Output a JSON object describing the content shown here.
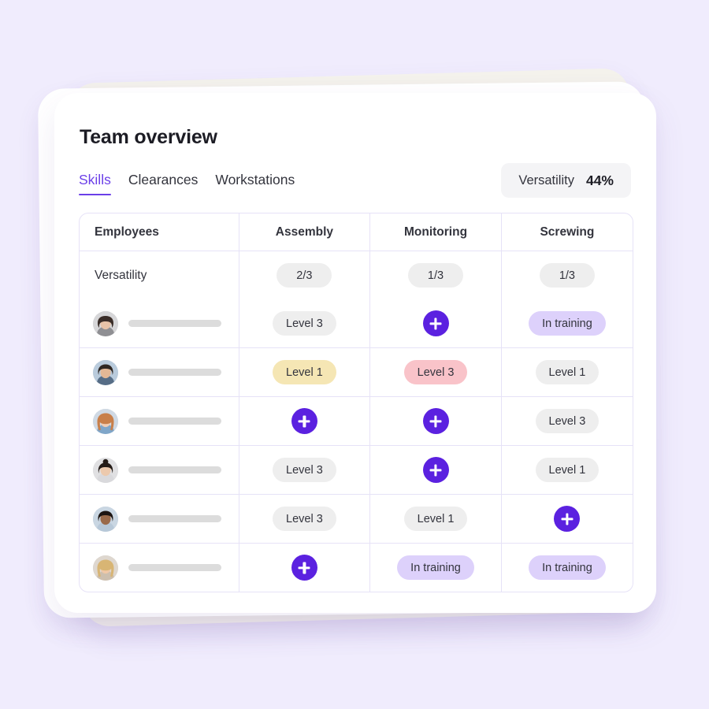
{
  "card": {
    "title": "Team overview",
    "tabs": [
      {
        "label": "Skills",
        "active": true
      },
      {
        "label": "Clearances",
        "active": false
      },
      {
        "label": "Workstations",
        "active": false
      }
    ],
    "versatility_pill": {
      "label": "Versatility",
      "value": "44%"
    }
  },
  "table": {
    "columns": [
      "Employees",
      "Assembly",
      "Monitoring",
      "Screwing"
    ],
    "versatility_row": {
      "label": "Versatility",
      "values": [
        "2/3",
        "1/3",
        "1/3"
      ]
    },
    "rows": [
      {
        "avatar": "avatar-1",
        "cells": [
          {
            "type": "badge",
            "label": "Level 3",
            "style": "gray"
          },
          {
            "type": "add",
            "label": "+"
          },
          {
            "type": "badge",
            "label": "In training",
            "style": "lavender"
          }
        ]
      },
      {
        "avatar": "avatar-2",
        "cells": [
          {
            "type": "badge",
            "label": "Level 1",
            "style": "yellow"
          },
          {
            "type": "badge",
            "label": "Level 3",
            "style": "pink"
          },
          {
            "type": "badge",
            "label": "Level 1",
            "style": "gray"
          }
        ]
      },
      {
        "avatar": "avatar-3",
        "cells": [
          {
            "type": "add",
            "label": "+"
          },
          {
            "type": "add",
            "label": "+"
          },
          {
            "type": "badge",
            "label": "Level 3",
            "style": "gray"
          }
        ]
      },
      {
        "avatar": "avatar-4",
        "cells": [
          {
            "type": "badge",
            "label": "Level 3",
            "style": "gray"
          },
          {
            "type": "add",
            "label": "+"
          },
          {
            "type": "badge",
            "label": "Level 1",
            "style": "gray"
          }
        ]
      },
      {
        "avatar": "avatar-5",
        "cells": [
          {
            "type": "badge",
            "label": "Level 3",
            "style": "gray"
          },
          {
            "type": "badge",
            "label": "Level 1",
            "style": "gray"
          },
          {
            "type": "add",
            "label": "+"
          }
        ]
      },
      {
        "avatar": "avatar-6",
        "cells": [
          {
            "type": "add",
            "label": "+"
          },
          {
            "type": "badge",
            "label": "In training",
            "style": "lavender"
          },
          {
            "type": "badge",
            "label": "In training",
            "style": "lavender"
          }
        ]
      }
    ]
  },
  "colors": {
    "background": "#f0ecfd",
    "accent": "#6b3fe8",
    "add_button": "#5b21e0",
    "grid_line": "#e6e2f7",
    "badge_gray": "#eeeeee",
    "badge_yellow": "#f5e6b4",
    "badge_pink": "#f9c3c9",
    "badge_lavender": "#ddd1fb"
  }
}
